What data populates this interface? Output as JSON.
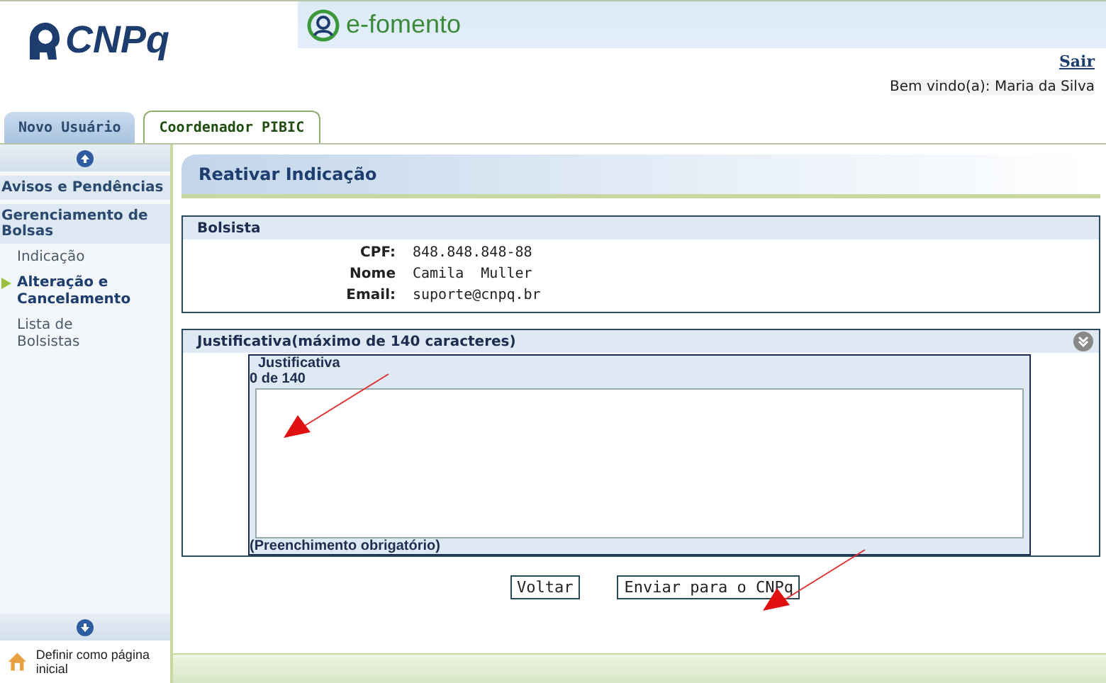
{
  "header": {
    "logo": "CNPq",
    "app_name": "e-fomento",
    "logout_link": "Sair",
    "welcome": "Bem vindo(a): Maria da Silva"
  },
  "tabs": [
    {
      "label": "Novo Usuário",
      "selected": false
    },
    {
      "label": "Coordenador PIBIC",
      "selected": true
    }
  ],
  "sidebar": {
    "sections": [
      {
        "label": "Avisos e Pendências"
      },
      {
        "label": "Gerenciamento de Bolsas",
        "children": [
          {
            "label": "Indicação",
            "selected": false
          },
          {
            "label": "Alteração e Cancelamento",
            "selected": true
          },
          {
            "label": "Lista de Bolsistas",
            "selected": false
          }
        ]
      }
    ],
    "home_link": "Definir como página inicial"
  },
  "page_title": "Reativar Indicação",
  "bolsista": {
    "title": "Bolsista",
    "fields": [
      {
        "label": "CPF:",
        "value": "848.848.848-88"
      },
      {
        "label": "Nome",
        "value": "Camila  Muller"
      },
      {
        "label": "Email:",
        "value": "suporte@cnpq.br"
      }
    ]
  },
  "justificativa": {
    "title": "Justificativa(máximo de 140 caracteres)",
    "field_label": "Justificativa",
    "counter": "0 de 140",
    "note": "(Preenchimento obrigatório)"
  },
  "buttons": [
    "Voltar",
    "Enviar para o CNPq"
  ]
}
